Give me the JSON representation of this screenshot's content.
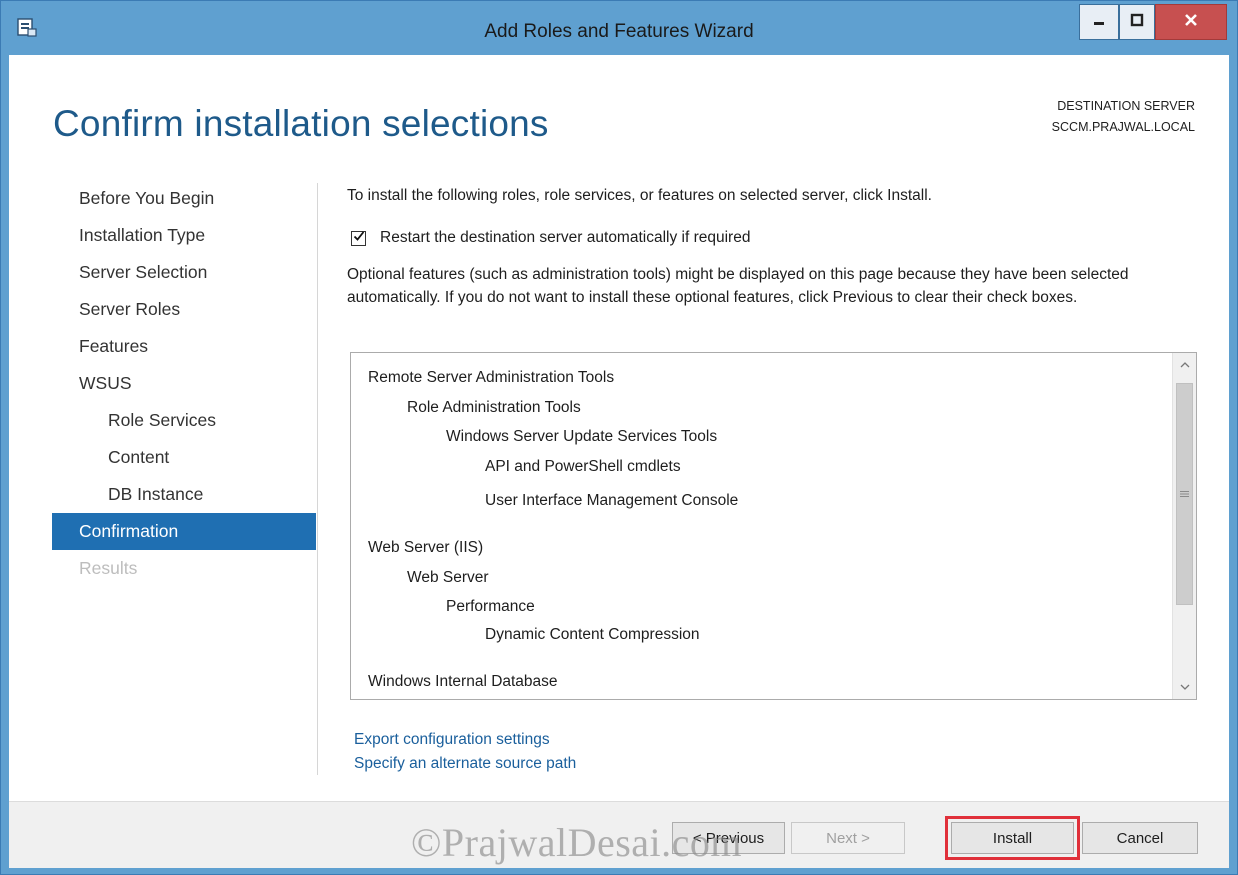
{
  "window": {
    "title": "Add Roles and Features Wizard",
    "minimize_glyph": "–",
    "maximize_glyph": "□",
    "close_glyph": "x"
  },
  "page": {
    "title": "Confirm installation selections",
    "destination_label": "DESTINATION SERVER",
    "destination_server": "SCCM.PRAJWAL.LOCAL"
  },
  "nav": {
    "items": [
      {
        "label": "Before You Begin",
        "state": "normal"
      },
      {
        "label": "Installation Type",
        "state": "normal"
      },
      {
        "label": "Server Selection",
        "state": "normal"
      },
      {
        "label": "Server Roles",
        "state": "normal"
      },
      {
        "label": "Features",
        "state": "normal"
      },
      {
        "label": "WSUS",
        "state": "normal"
      },
      {
        "label": "Role Services",
        "state": "sub"
      },
      {
        "label": "Content",
        "state": "sub"
      },
      {
        "label": "DB Instance",
        "state": "sub"
      },
      {
        "label": "Confirmation",
        "state": "active"
      },
      {
        "label": "Results",
        "state": "disabled"
      }
    ]
  },
  "main": {
    "intro": "To install the following roles, role services, or features on selected server, click Install.",
    "restart_checkbox": {
      "checked": true,
      "label": "Restart the destination server automatically if required"
    },
    "optional_text": "Optional features (such as administration tools) might be displayed on this page because they have been selected automatically. If you do not want to install these optional features, click Previous to clear their check boxes.",
    "features": [
      {
        "label": "Remote Server Administration Tools",
        "level": 0
      },
      {
        "label": "Role Administration Tools",
        "level": 1
      },
      {
        "label": "Windows Server Update Services Tools",
        "level": 2
      },
      {
        "label": "API and PowerShell cmdlets",
        "level": 3
      },
      {
        "label": "User Interface Management Console",
        "level": 3
      },
      {
        "label": "Web Server (IIS)",
        "level": 0
      },
      {
        "label": "Web Server",
        "level": 1
      },
      {
        "label": "Performance",
        "level": 2
      },
      {
        "label": "Dynamic Content Compression",
        "level": 3
      },
      {
        "label": "Windows Internal Database",
        "level": 0
      }
    ],
    "links": {
      "export": "Export configuration settings",
      "alternate_source": "Specify an alternate source path"
    }
  },
  "footer": {
    "previous": "< Previous",
    "next": "Next >",
    "install": "Install",
    "cancel": "Cancel"
  },
  "watermark": "©PrajwalDesai.com",
  "colors": {
    "titlebar": "#5fa0d0",
    "accent": "#1f6fb2",
    "heading": "#1e5a8a",
    "link": "#1a5f9c",
    "highlight": "#e0303a"
  }
}
